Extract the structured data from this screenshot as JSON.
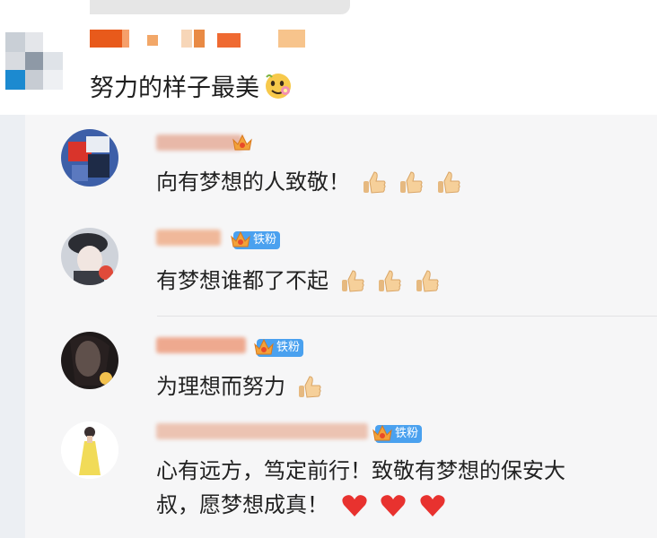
{
  "post": {
    "text": "努力的样子最美",
    "emoji": "blossom-face-emoji"
  },
  "comments": [
    {
      "text": "向有梦想的人致敬！",
      "reactions": [
        "thumbs-up-icon",
        "thumbs-up-icon",
        "thumbs-up-icon"
      ]
    },
    {
      "badge": "铁粉",
      "text": "有梦想谁都了不起",
      "reactions": [
        "thumbs-up-icon",
        "thumbs-up-icon",
        "thumbs-up-icon"
      ]
    },
    {
      "badge": "铁粉",
      "text": "为理想而努力",
      "reactions": [
        "thumbs-up-icon"
      ]
    },
    {
      "badge": "铁粉",
      "line1": "心有远方，笃定前行！致敬有梦想的保安大",
      "line2": "叔，愿梦想成真！",
      "reactions": [
        "heart-icon",
        "heart-icon",
        "heart-icon"
      ]
    }
  ],
  "colors": {
    "fan_badge": "#4aa1ef",
    "crown": "#f2a23a",
    "heart": "#e8322f"
  }
}
